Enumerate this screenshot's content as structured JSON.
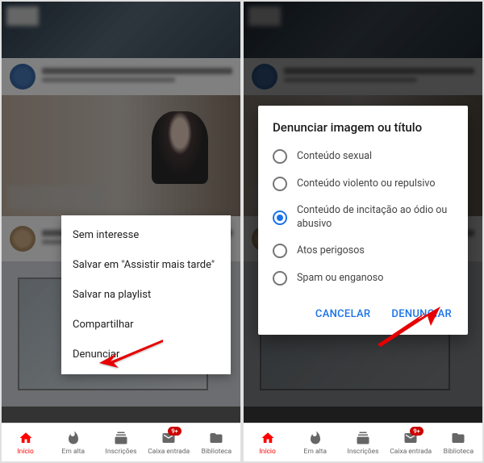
{
  "left": {
    "context_menu": {
      "items": [
        {
          "label": "Sem interesse"
        },
        {
          "label": "Salvar em \"Assistir mais tarde\""
        },
        {
          "label": "Salvar na playlist"
        },
        {
          "label": "Compartilhar"
        },
        {
          "label": "Denunciar"
        }
      ]
    }
  },
  "right": {
    "dialog": {
      "title": "Denunciar imagem ou título",
      "options": [
        {
          "label": "Conteúdo sexual",
          "selected": false
        },
        {
          "label": "Conteúdo violento ou repulsivo",
          "selected": false
        },
        {
          "label": "Conteúdo de incitação ao ódio ou abusivo",
          "selected": true
        },
        {
          "label": "Atos perigosos",
          "selected": false
        },
        {
          "label": "Spam ou enganoso",
          "selected": false
        }
      ],
      "cancel_label": "CANCELAR",
      "confirm_label": "DENUNCIAR"
    }
  },
  "nav": {
    "items": [
      {
        "label": "Início",
        "active": true,
        "badge": null
      },
      {
        "label": "Em alta",
        "active": false,
        "badge": null
      },
      {
        "label": "Inscrições",
        "active": false,
        "badge": null
      },
      {
        "label": "Caixa entrada",
        "active": false,
        "badge": "9+"
      },
      {
        "label": "Biblioteca",
        "active": false,
        "badge": null
      }
    ]
  }
}
